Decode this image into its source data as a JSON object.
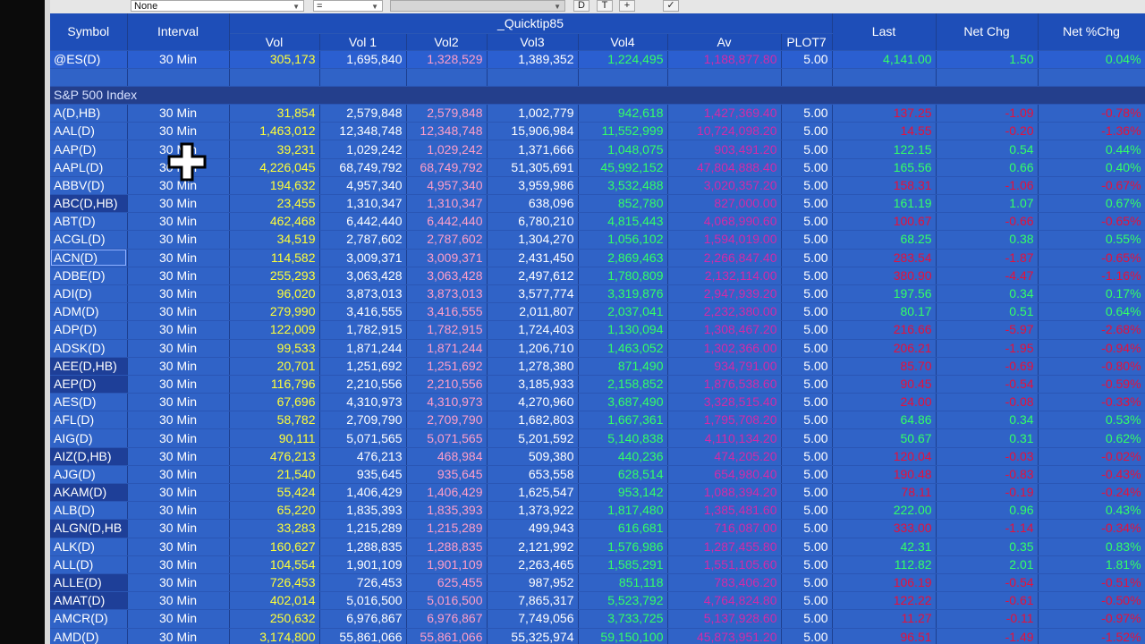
{
  "toolbar": {
    "field1": "None",
    "field2": "=",
    "btn_d": "D",
    "btn_t": "T",
    "btn_plus": "+",
    "btn_check": "✓"
  },
  "headers": {
    "symbol": "Symbol",
    "interval": "Interval",
    "group": "_Quicktip85",
    "vol": "Vol",
    "vol1": "Vol 1",
    "vol2": "Vol2",
    "vol3": "Vol3",
    "vol4": "Vol4",
    "av": "Av",
    "plot7": "PLOT7",
    "last": "Last",
    "net_chg": "Net Chg",
    "net_pct": "Net %Chg"
  },
  "es_row": [
    "@ES(D)",
    "30 Min",
    "305,173",
    "1,695,840",
    "1,328,529",
    "1,389,352",
    "1,224,495",
    "1,188,877.80",
    "5.00",
    "4,141.00",
    "1.50",
    "0.04%"
  ],
  "section_label": "S&P 500 Index",
  "rows": [
    [
      "A(D,HB)",
      "30 Min",
      "31,854",
      "2,579,848",
      "2,579,848",
      "1,002,779",
      "942,618",
      "1,427,369.40",
      "5.00",
      "137.25",
      "-1.09",
      "-0.78%"
    ],
    [
      "AAL(D)",
      "30 Min",
      "1,463,012",
      "12,348,748",
      "12,348,748",
      "15,906,984",
      "11,552,999",
      "10,724,098.20",
      "5.00",
      "14.55",
      "-0.20",
      "-1.36%"
    ],
    [
      "AAP(D)",
      "30 Min",
      "39,231",
      "1,029,242",
      "1,029,242",
      "1,371,666",
      "1,048,075",
      "903,491.20",
      "5.00",
      "122.15",
      "0.54",
      "0.44%"
    ],
    [
      "AAPL(D)",
      "30 Min",
      "4,226,045",
      "68,749,792",
      "68,749,792",
      "51,305,691",
      "45,992,152",
      "47,804,888.40",
      "5.00",
      "165.56",
      "0.66",
      "0.40%"
    ],
    [
      "ABBV(D)",
      "30 Min",
      "194,632",
      "4,957,340",
      "4,957,340",
      "3,959,986",
      "3,532,488",
      "3,020,357.20",
      "5.00",
      "158.31",
      "-1.06",
      "-0.67%"
    ],
    [
      "ABC(D,HB)",
      "30 Min",
      "23,455",
      "1,310,347",
      "1,310,347",
      "638,096",
      "852,780",
      "827,000.00",
      "5.00",
      "161.19",
      "1.07",
      "0.67%"
    ],
    [
      "ABT(D)",
      "30 Min",
      "462,468",
      "6,442,440",
      "6,442,440",
      "6,780,210",
      "4,815,443",
      "4,068,990.60",
      "5.00",
      "100.67",
      "-0.66",
      "-0.65%"
    ],
    [
      "ACGL(D)",
      "30 Min",
      "34,519",
      "2,787,602",
      "2,787,602",
      "1,304,270",
      "1,056,102",
      "1,594,019.00",
      "5.00",
      "68.25",
      "0.38",
      "0.55%"
    ],
    [
      "ACN(D)",
      "30 Min",
      "114,582",
      "3,009,371",
      "3,009,371",
      "2,431,450",
      "2,869,463",
      "2,266,847.40",
      "5.00",
      "283.54",
      "-1.87",
      "-0.65%"
    ],
    [
      "ADBE(D)",
      "30 Min",
      "255,293",
      "3,063,428",
      "3,063,428",
      "2,497,612",
      "1,780,809",
      "2,132,114.00",
      "5.00",
      "380.90",
      "-4.47",
      "-1.16%"
    ],
    [
      "ADI(D)",
      "30 Min",
      "96,020",
      "3,873,013",
      "3,873,013",
      "3,577,774",
      "3,319,876",
      "2,947,939.20",
      "5.00",
      "197.56",
      "0.34",
      "0.17%"
    ],
    [
      "ADM(D)",
      "30 Min",
      "279,990",
      "3,416,555",
      "3,416,555",
      "2,011,807",
      "2,037,041",
      "2,232,380.00",
      "5.00",
      "80.17",
      "0.51",
      "0.64%"
    ],
    [
      "ADP(D)",
      "30 Min",
      "122,009",
      "1,782,915",
      "1,782,915",
      "1,724,403",
      "1,130,094",
      "1,308,467.20",
      "5.00",
      "216.66",
      "-5.97",
      "-2.68%"
    ],
    [
      "ADSK(D)",
      "30 Min",
      "99,533",
      "1,871,244",
      "1,871,244",
      "1,206,710",
      "1,463,052",
      "1,302,366.00",
      "5.00",
      "206.21",
      "-1.95",
      "-0.94%"
    ],
    [
      "AEE(D,HB)",
      "30 Min",
      "20,701",
      "1,251,692",
      "1,251,692",
      "1,278,380",
      "871,490",
      "934,791.00",
      "5.00",
      "85.70",
      "-0.69",
      "-0.80%"
    ],
    [
      "AEP(D)",
      "30 Min",
      "116,796",
      "2,210,556",
      "2,210,556",
      "3,185,933",
      "2,158,852",
      "1,876,538.60",
      "5.00",
      "90.45",
      "-0.54",
      "-0.59%"
    ],
    [
      "AES(D)",
      "30 Min",
      "67,696",
      "4,310,973",
      "4,310,973",
      "4,270,960",
      "3,687,490",
      "3,328,515.40",
      "5.00",
      "24.00",
      "-0.08",
      "-0.33%"
    ],
    [
      "AFL(D)",
      "30 Min",
      "58,782",
      "2,709,790",
      "2,709,790",
      "1,682,803",
      "1,667,361",
      "1,795,708.20",
      "5.00",
      "64.86",
      "0.34",
      "0.53%"
    ],
    [
      "AIG(D)",
      "30 Min",
      "90,111",
      "5,071,565",
      "5,071,565",
      "5,201,592",
      "5,140,838",
      "4,110,134.20",
      "5.00",
      "50.67",
      "0.31",
      "0.62%"
    ],
    [
      "AIZ(D,HB)",
      "30 Min",
      "476,213",
      "476,213",
      "468,984",
      "509,380",
      "440,236",
      "474,205.20",
      "5.00",
      "120.04",
      "-0.03",
      "-0.02%"
    ],
    [
      "AJG(D)",
      "30 Min",
      "21,540",
      "935,645",
      "935,645",
      "653,558",
      "628,514",
      "654,980.40",
      "5.00",
      "190.48",
      "-0.83",
      "-0.43%"
    ],
    [
      "AKAM(D)",
      "30 Min",
      "55,424",
      "1,406,429",
      "1,406,429",
      "1,625,547",
      "953,142",
      "1,088,394.20",
      "5.00",
      "78.11",
      "-0.19",
      "-0.24%"
    ],
    [
      "ALB(D)",
      "30 Min",
      "65,220",
      "1,835,393",
      "1,835,393",
      "1,373,922",
      "1,817,480",
      "1,385,481.60",
      "5.00",
      "222.00",
      "0.96",
      "0.43%"
    ],
    [
      "ALGN(D,HB",
      "30 Min",
      "33,283",
      "1,215,289",
      "1,215,289",
      "499,943",
      "616,681",
      "716,087.00",
      "5.00",
      "333.00",
      "-1.14",
      "-0.34%"
    ],
    [
      "ALK(D)",
      "30 Min",
      "160,627",
      "1,288,835",
      "1,288,835",
      "2,121,992",
      "1,576,986",
      "1,287,455.80",
      "5.00",
      "42.31",
      "0.35",
      "0.83%"
    ],
    [
      "ALL(D)",
      "30 Min",
      "104,554",
      "1,901,109",
      "1,901,109",
      "2,263,465",
      "1,585,291",
      "1,551,105.60",
      "5.00",
      "112.82",
      "2.01",
      "1.81%"
    ],
    [
      "ALLE(D)",
      "30 Min",
      "726,453",
      "726,453",
      "625,455",
      "987,952",
      "851,118",
      "783,406.20",
      "5.00",
      "106.19",
      "-0.54",
      "-0.51%"
    ],
    [
      "AMAT(D)",
      "30 Min",
      "402,014",
      "5,016,500",
      "5,016,500",
      "7,865,317",
      "5,523,792",
      "4,764,824.80",
      "5.00",
      "122.22",
      "-0.61",
      "-0.50%"
    ],
    [
      "AMCR(D)",
      "30 Min",
      "250,632",
      "6,976,867",
      "6,976,867",
      "7,749,056",
      "3,733,725",
      "5,137,928.60",
      "5.00",
      "11.27",
      "-0.11",
      "-0.97%"
    ],
    [
      "AMD(D)",
      "30 Min",
      "3,174,800",
      "55,861,066",
      "55,861,066",
      "55,325,974",
      "59,150,100",
      "45,873,951.20",
      "5.00",
      "96.51",
      "-1.49",
      "-1.52%"
    ]
  ],
  "dark_symbols": [
    "ABC(D,HB)",
    "AEE(D,HB)",
    "AEP(D)",
    "AIZ(D,HB)",
    "AKAM(D)",
    "ALGN(D,HB",
    "ALLE(D)",
    "AMAT(D)"
  ],
  "outlined_symbol": "ACN(D)",
  "cursor_icon": "move-cross-cursor"
}
